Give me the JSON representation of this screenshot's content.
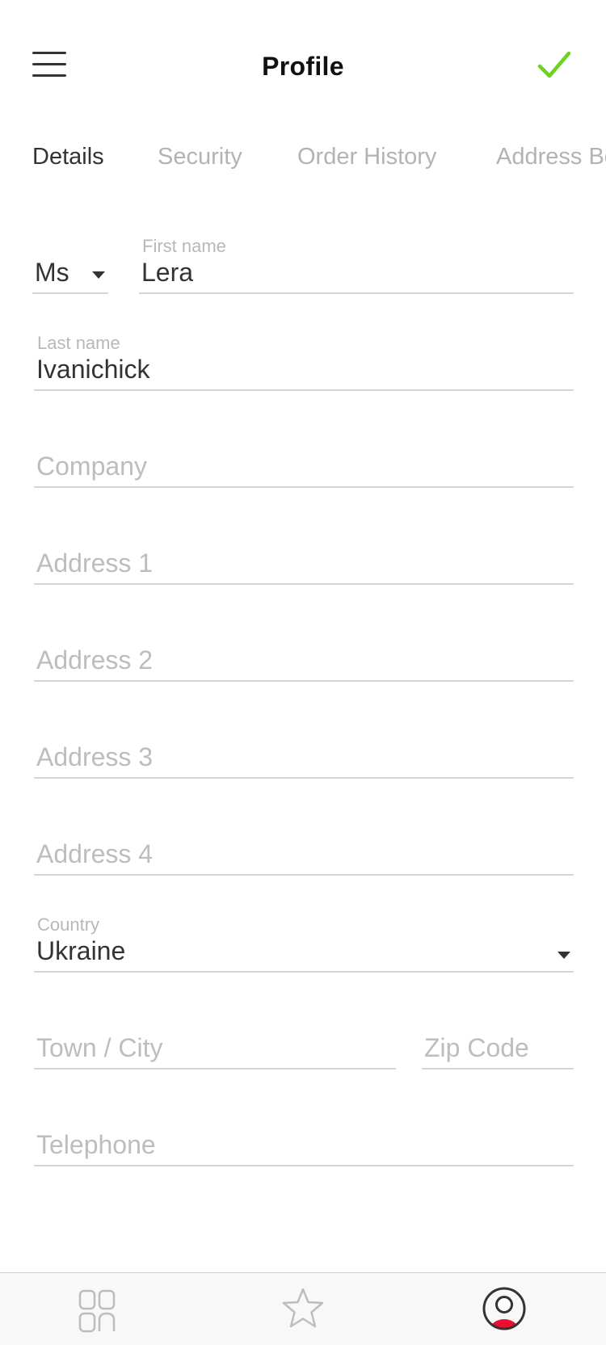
{
  "header": {
    "title": "Profile",
    "menu_icon": "hamburger-menu-icon",
    "confirm_icon": "checkmark-icon",
    "accent_color": "#6cd21e"
  },
  "tabs": [
    {
      "label": "Details",
      "active": true
    },
    {
      "label": "Security",
      "active": false
    },
    {
      "label": "Order History",
      "active": false
    },
    {
      "label": "Address Book",
      "active": false
    }
  ],
  "form": {
    "title_select": {
      "value": "Ms"
    },
    "first_name": {
      "label": "First name",
      "value": "Lera"
    },
    "last_name": {
      "label": "Last name",
      "value": "Ivanichick"
    },
    "company": {
      "placeholder": "Company",
      "value": ""
    },
    "address1": {
      "placeholder": "Address 1",
      "value": ""
    },
    "address2": {
      "placeholder": "Address 2",
      "value": ""
    },
    "address3": {
      "placeholder": "Address 3",
      "value": ""
    },
    "address4": {
      "placeholder": "Address 4",
      "value": ""
    },
    "country": {
      "label": "Country",
      "value": "Ukraine"
    },
    "town": {
      "placeholder": "Town / City",
      "value": ""
    },
    "zip": {
      "placeholder": "Zip Code",
      "value": ""
    },
    "telephone": {
      "placeholder": "Telephone",
      "value": ""
    }
  },
  "bottom_nav": {
    "items": [
      {
        "icon": "grid-icon",
        "active": false
      },
      {
        "icon": "star-icon",
        "active": false
      },
      {
        "icon": "user-profile-icon",
        "active": true
      }
    ],
    "active_color": "#e8102f"
  }
}
